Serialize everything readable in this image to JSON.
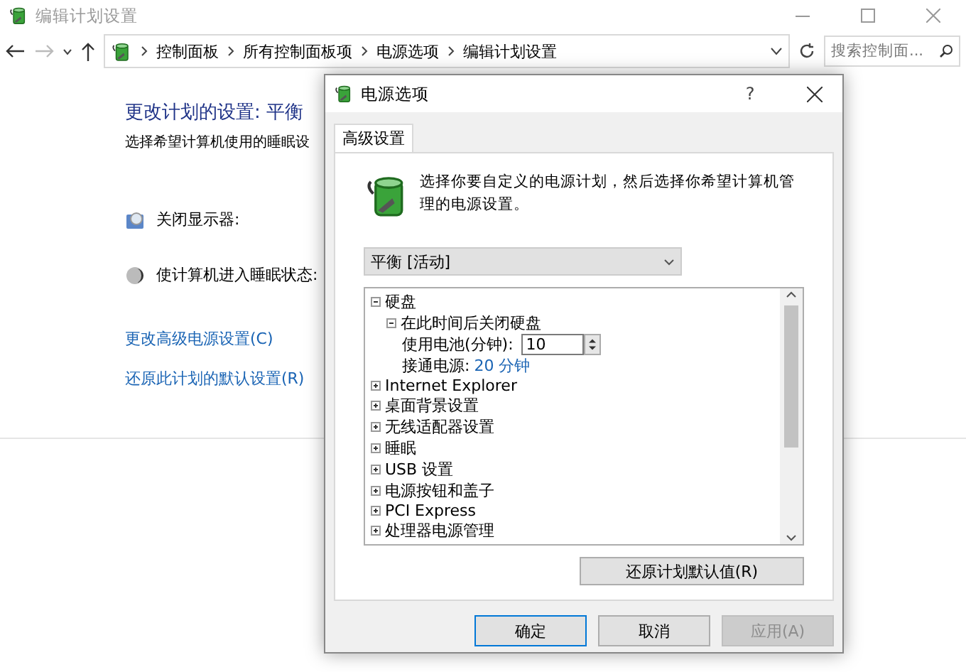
{
  "window": {
    "title": "编辑计划设置"
  },
  "nav": {
    "breadcrumb": [
      "控制面板",
      "所有控制面板项",
      "电源选项",
      "编辑计划设置"
    ],
    "search": {
      "placeholder": "搜索控制面..."
    }
  },
  "main": {
    "heading": "更改计划的设置: 平衡",
    "subtitle": "选择希望计算机使用的睡眠设",
    "settings": [
      {
        "label": "关闭显示器:",
        "kind": "display"
      },
      {
        "label": "使计算机进入睡眠状态:",
        "kind": "sleep"
      }
    ],
    "links": [
      "更改高级电源设置(C)",
      "还原此计划的默认设置(R)"
    ]
  },
  "dialog": {
    "title": "电源选项",
    "help": "?",
    "tabs": [
      {
        "label": "高级设置",
        "selected": true
      }
    ],
    "intro": "选择你要自定义的电源计划，然后选择你希望计算机管理的电源设置。",
    "plan": "平衡 [活动]",
    "tree": [
      {
        "label": "硬盘",
        "kind": "group",
        "expanded": true,
        "children": [
          {
            "label": "在此时间后关闭硬盘",
            "kind": "group",
            "expanded": true,
            "children": [
              {
                "kind": "spin",
                "label": "使用电池(分钟):",
                "value": "10"
              },
              {
                "kind": "link",
                "label": "接通电源:",
                "value": "20 分钟"
              }
            ]
          }
        ]
      },
      {
        "label": "Internet Explorer",
        "kind": "group",
        "expanded": false
      },
      {
        "label": "桌面背景设置",
        "kind": "group",
        "expanded": false
      },
      {
        "label": "无线适配器设置",
        "kind": "group",
        "expanded": false
      },
      {
        "label": "睡眠",
        "kind": "group",
        "expanded": false
      },
      {
        "label": "USB 设置",
        "kind": "group",
        "expanded": false
      },
      {
        "label": "电源按钮和盖子",
        "kind": "group",
        "expanded": false
      },
      {
        "label": "PCI Express",
        "kind": "group",
        "expanded": false
      },
      {
        "label": "处理器电源管理",
        "kind": "group",
        "expanded": false
      }
    ],
    "restore_button": "还原计划默认值(R)",
    "buttons": [
      {
        "label": "确定",
        "kind": "default",
        "disabled": false
      },
      {
        "label": "取消",
        "kind": "normal",
        "disabled": false
      },
      {
        "label": "应用(A)",
        "kind": "normal",
        "disabled": true
      }
    ]
  }
}
